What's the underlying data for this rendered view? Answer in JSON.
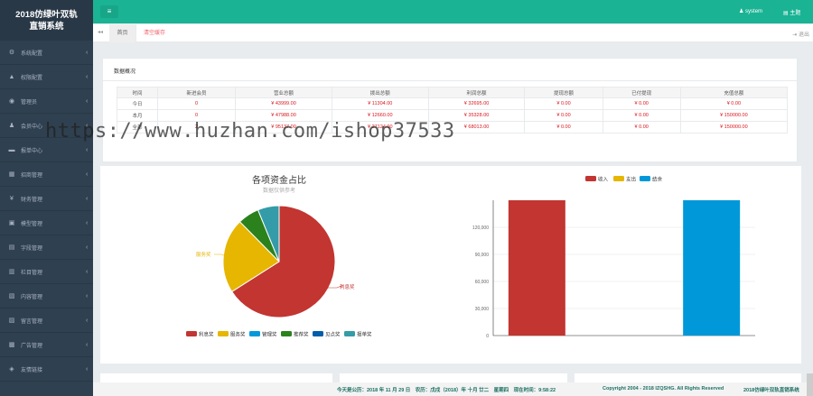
{
  "brand": {
    "line1": "2018仿绿叶双轨",
    "line2": "直销系统"
  },
  "sidebar": {
    "items": [
      {
        "label": "系统配置",
        "icon": "gear-icon",
        "glyph": "⚙"
      },
      {
        "label": "权限配置",
        "icon": "lock-icon",
        "glyph": "▲"
      },
      {
        "label": "管理员",
        "icon": "admin-icon",
        "glyph": "◉"
      },
      {
        "label": "会员中心",
        "icon": "user-icon",
        "glyph": "♟"
      },
      {
        "label": "报单中心",
        "icon": "cart-icon",
        "glyph": "▬"
      },
      {
        "label": "招商管理",
        "icon": "grid-icon",
        "glyph": "▦"
      },
      {
        "label": "财务管理",
        "icon": "yen-icon",
        "glyph": "¥"
      },
      {
        "label": "模型管理",
        "icon": "cube-icon",
        "glyph": "▣"
      },
      {
        "label": "字段管理",
        "icon": "field-icon",
        "glyph": "▤"
      },
      {
        "label": "栏目管理",
        "icon": "column-icon",
        "glyph": "▥"
      },
      {
        "label": "内容管理",
        "icon": "content-icon",
        "glyph": "▧"
      },
      {
        "label": "留言管理",
        "icon": "message-icon",
        "glyph": "▨"
      },
      {
        "label": "广告管理",
        "icon": "ad-icon",
        "glyph": "▩"
      },
      {
        "label": "友情链接",
        "icon": "link-icon",
        "glyph": "◈"
      }
    ],
    "chevron": "‹"
  },
  "topbar": {
    "menu": "≡",
    "user": "system",
    "theme": "主题"
  },
  "tabs": {
    "back": "◂◂",
    "home": "首页",
    "clear": "清空缓存",
    "logout": "退出"
  },
  "panel": {
    "title": "数据概况"
  },
  "stats": {
    "headers": [
      "时间",
      "新进会员",
      "营业总额",
      "拨出总额",
      "利润总额",
      "提现总额",
      "已付提现",
      "充值总额"
    ],
    "rows": [
      [
        "今日",
        "0",
        "¥ 43999.00",
        "¥ 11304.00",
        "¥ 32695.00",
        "¥ 0.00",
        "¥ 0.00",
        "¥ 0.00"
      ],
      [
        "本月",
        "0",
        "¥ 47988.00",
        "¥ 12660.00",
        "¥ 35328.00",
        "¥ 0.00",
        "¥ 0.00",
        "¥ 150000.00"
      ],
      [
        "全部",
        "2",
        "¥ 95137.00",
        "¥ 27124.00",
        "¥ 68013.00",
        "¥ 0.00",
        "¥ 0.00",
        "¥ 150000.00"
      ]
    ]
  },
  "chart_data": [
    {
      "type": "pie",
      "title": "各项资金占比",
      "subtitle": "数据仅供参考",
      "series": [
        {
          "name": "利息奖",
          "value": 64,
          "color": "#c23531"
        },
        {
          "name": "服务奖",
          "value": 21,
          "color": "#e6b600"
        },
        {
          "name": "管理奖",
          "value": 0,
          "color": "#0098d9"
        },
        {
          "name": "推荐奖",
          "value": 6,
          "color": "#2b821d"
        },
        {
          "name": "见点奖",
          "value": 0,
          "color": "#005eaa"
        },
        {
          "name": "报单奖",
          "value": 6,
          "color": "#339ca8"
        }
      ],
      "slice_labels": [
        "利息奖",
        "服务奖"
      ]
    },
    {
      "type": "bar",
      "series": [
        {
          "name": "收入",
          "value": 150000,
          "color": "#c23531"
        },
        {
          "name": "支出",
          "value": 0,
          "color": "#e6b600"
        },
        {
          "name": "结余",
          "value": 150000,
          "color": "#0098d9"
        }
      ],
      "yticks": [
        "0",
        "30,000",
        "60,000",
        "90,000",
        "120,000"
      ],
      "ylim": [
        0,
        150000
      ]
    }
  ],
  "watermark": "https://www.huzhan.com/ishop37533",
  "footer": {
    "date": "今天是公历：2018 年 11 月 29 日　农历：戊戌（2018）年 十月 廿二　星期四　现在时间：9:58:22",
    "copyright": "Copyright 2004 - 2018 IZQSHG. All Rights Reserved",
    "system": "2018仿绿叶双轨直销系统"
  },
  "colors": {
    "sidebar": "#2f4050",
    "accent": "#1ab394",
    "money": "#d9161c"
  }
}
